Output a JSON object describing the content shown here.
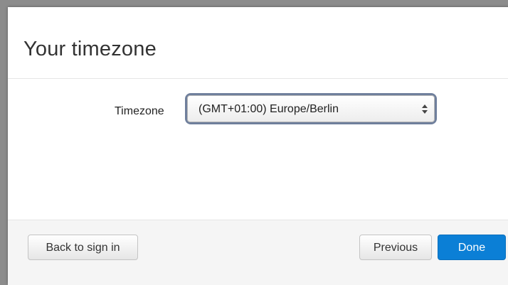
{
  "dialog": {
    "title": "Your timezone"
  },
  "form": {
    "timezone_label": "Timezone",
    "timezone_selected": "(GMT+01:00) Europe/Berlin"
  },
  "footer": {
    "back_label": "Back to sign in",
    "previous_label": "Previous",
    "done_label": "Done"
  },
  "colors": {
    "primary": "#0b7fd6",
    "focus_ring": "#6f7f9c",
    "backdrop": "#8c8c8c"
  },
  "icons": {
    "select_arrows": "updown-arrows-icon"
  }
}
